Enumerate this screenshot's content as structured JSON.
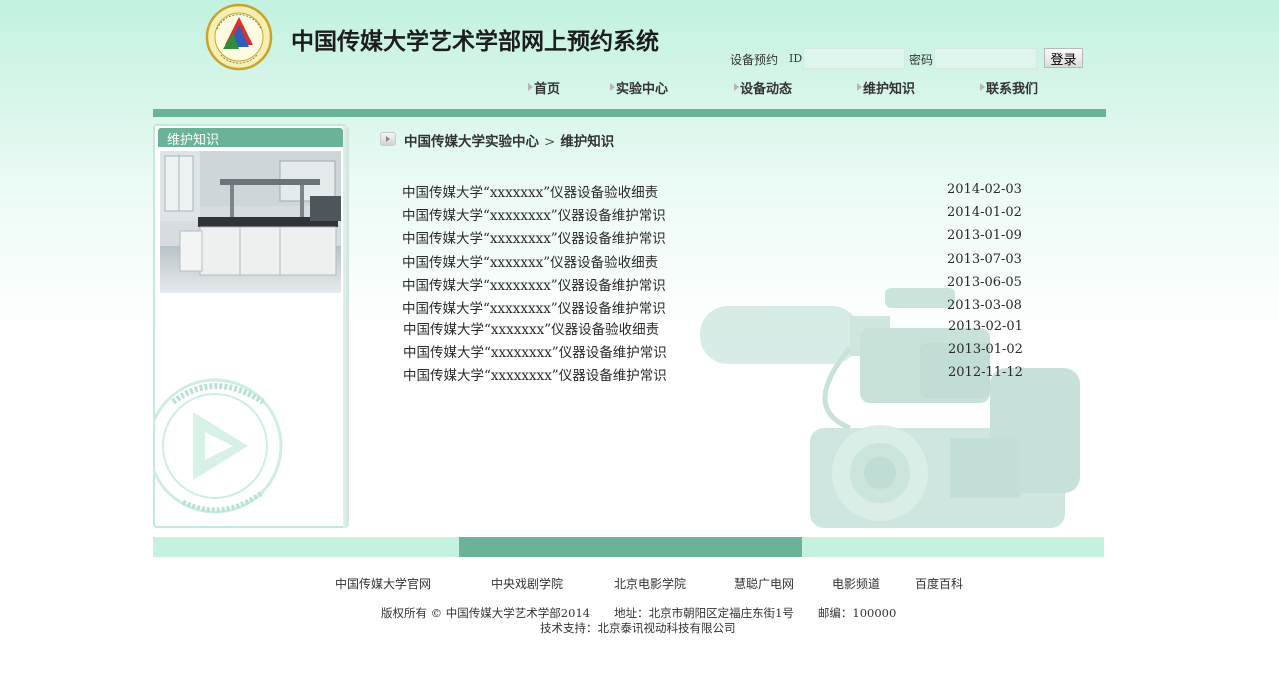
{
  "header": {
    "title": "中国传媒大学艺术学部网上预约系统",
    "logo_icon": "university-emblem-icon"
  },
  "login": {
    "label": "设备预约",
    "id_label": "ID",
    "id_value": "",
    "password_label": "密码",
    "password_value": "",
    "submit_label": "登录"
  },
  "nav": {
    "items": [
      {
        "label": "首页"
      },
      {
        "label": "实验中心"
      },
      {
        "label": "设备动态"
      },
      {
        "label": "维护知识"
      },
      {
        "label": "联系我们"
      }
    ]
  },
  "sidebar": {
    "title": "维护知识"
  },
  "breadcrumb": {
    "root": "中国传媒大学实验中心",
    "separator": ">",
    "current": "维护知识"
  },
  "articles": [
    {
      "title": "中国传媒大学“xxxxxxx”仪器设备验收细责",
      "date": "2014-02-03"
    },
    {
      "title": "中国传媒大学“xxxxxxxx”仪器设备维护常识",
      "date": "2014-01-02"
    },
    {
      "title": "中国传媒大学“xxxxxxxx”仪器设备维护常识",
      "date": "2013-01-09"
    },
    {
      "title": "中国传媒大学“xxxxxxx”仪器设备验收细责",
      "date": "2013-07-03"
    },
    {
      "title": "中国传媒大学“xxxxxxxx”仪器设备维护常识",
      "date": "2013-06-05"
    },
    {
      "title": "中国传媒大学“xxxxxxxx”仪器设备维护常识",
      "date": "2013-03-08"
    },
    {
      "title": "中国传媒大学“xxxxxxx”仪器设备验收细责",
      "date": "2013-02-01"
    },
    {
      "title": "中国传媒大学“xxxxxxxx”仪器设备维护常识",
      "date": "2013-01-02"
    },
    {
      "title": "中国传媒大学“xxxxxxxx”仪器设备维护常识",
      "date": "2012-11-12"
    }
  ],
  "footer": {
    "links": [
      {
        "label": "中国传媒大学官网"
      },
      {
        "label": "中央戏剧学院"
      },
      {
        "label": "北京电影学院"
      },
      {
        "label": "慧聪广电网"
      },
      {
        "label": "电影频道"
      },
      {
        "label": "百度百科"
      }
    ],
    "copyright": "版权所有 © 中国传媒大学艺术学部2014",
    "address": "地址：北京市朝阳区定福庄东街1号",
    "postcode": "邮编：100000",
    "tech_support": "技术支持：北京泰讯视动科技有限公司"
  },
  "colors": {
    "accent": "#6ab398",
    "light_accent": "#c5f2df"
  }
}
